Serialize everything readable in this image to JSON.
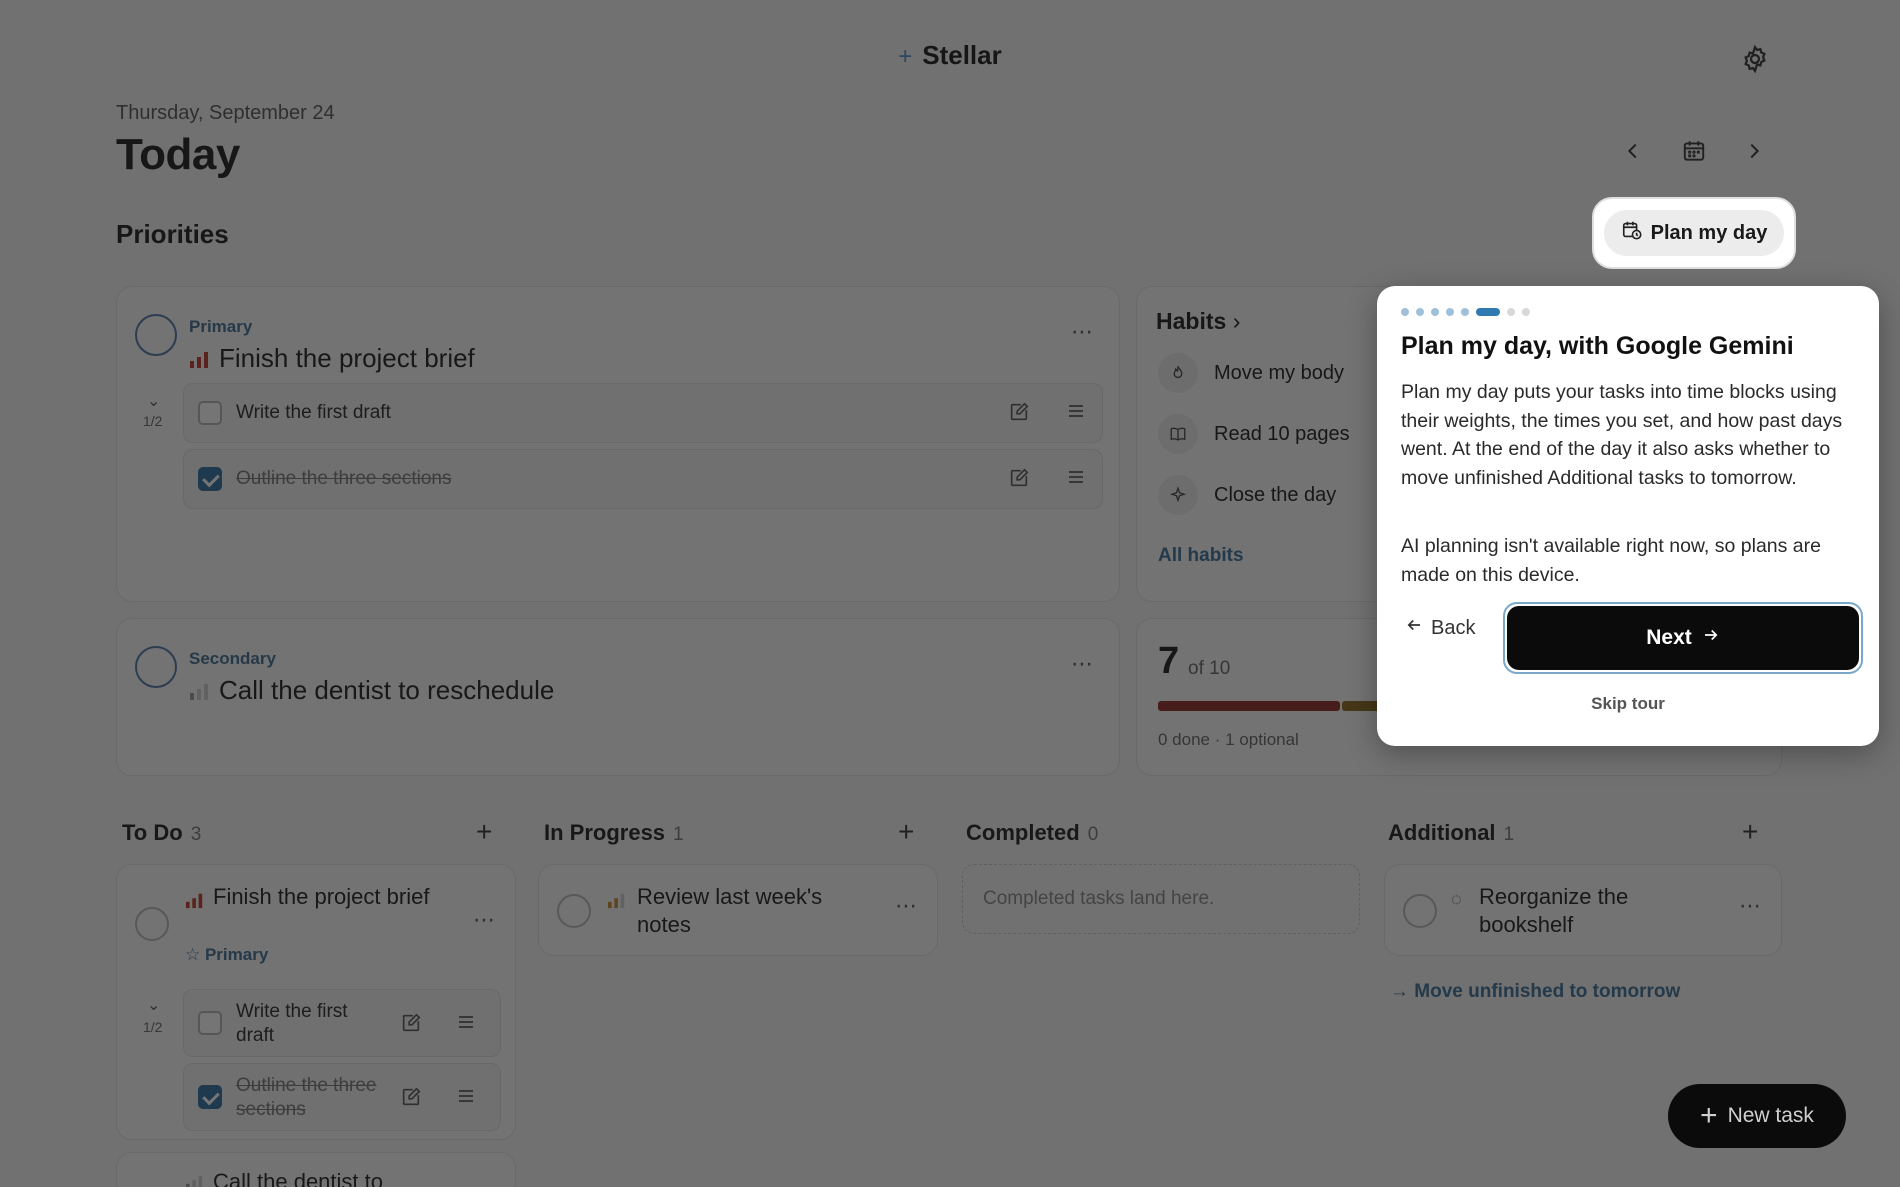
{
  "app": {
    "name": "Stellar"
  },
  "header": {
    "date": "Thursday, September 24",
    "title": "Today"
  },
  "priorities": {
    "section_title": "Priorities",
    "primary": {
      "label": "Primary",
      "title": "Finish the project brief",
      "progress": "1/2",
      "subtasks": [
        {
          "text": "Write the first draft",
          "done": false
        },
        {
          "text": "Outline the three sections",
          "done": true
        }
      ]
    },
    "secondary": {
      "label": "Secondary",
      "title": "Call the dentist to reschedule"
    }
  },
  "plan_button": {
    "label": "Plan my day"
  },
  "habits": {
    "title": "Habits",
    "items": [
      {
        "label": "Move my body",
        "icon": "flame-icon"
      },
      {
        "label": "Read 10 pages",
        "icon": "book-icon"
      },
      {
        "label": "Close the day",
        "icon": "sparkle-icon"
      }
    ],
    "all_link": "All habits"
  },
  "score": {
    "value": "7",
    "of": "of 10",
    "meta": "0 done · 1 optional",
    "colors": [
      "#8e2a22",
      "#8b6a1e"
    ]
  },
  "columns": [
    {
      "title": "To Do",
      "count": "3"
    },
    {
      "title": "In Progress",
      "count": "1"
    },
    {
      "title": "Completed",
      "count": "0"
    },
    {
      "title": "Additional",
      "count": "1"
    }
  ],
  "todo": {
    "card1": {
      "title": "Finish the project brief",
      "tag": "Primary",
      "progress": "1/2",
      "subtasks": [
        {
          "text": "Write the first draft",
          "done": false
        },
        {
          "text": "Outline the three sections",
          "done": true
        }
      ]
    },
    "card2_partial": "Call the dentist to"
  },
  "in_progress": {
    "card1": {
      "title": "Review last week's notes"
    }
  },
  "completed": {
    "empty": "Completed tasks land here."
  },
  "additional": {
    "card1": {
      "title": "Reorganize the bookshelf"
    },
    "move_link": "Move unfinished to tomorrow"
  },
  "tour": {
    "step_current": 6,
    "step_total": 8,
    "title": "Plan my day, with Google Gemini",
    "body1": "Plan my day puts your tasks into time blocks using their weights, the times you set, and how past days went. At the end of the day it also asks whether to move unfinished Additional tasks to tomorrow.",
    "body2": "AI planning isn't available right now, so plans are made on this device.",
    "back": "Back",
    "next": "Next",
    "skip": "Skip tour"
  },
  "fab": {
    "label": "New task"
  },
  "colors": {
    "accent": "#3f6d93",
    "checked": "#2e6da4",
    "priority_high": "#c0392b"
  }
}
